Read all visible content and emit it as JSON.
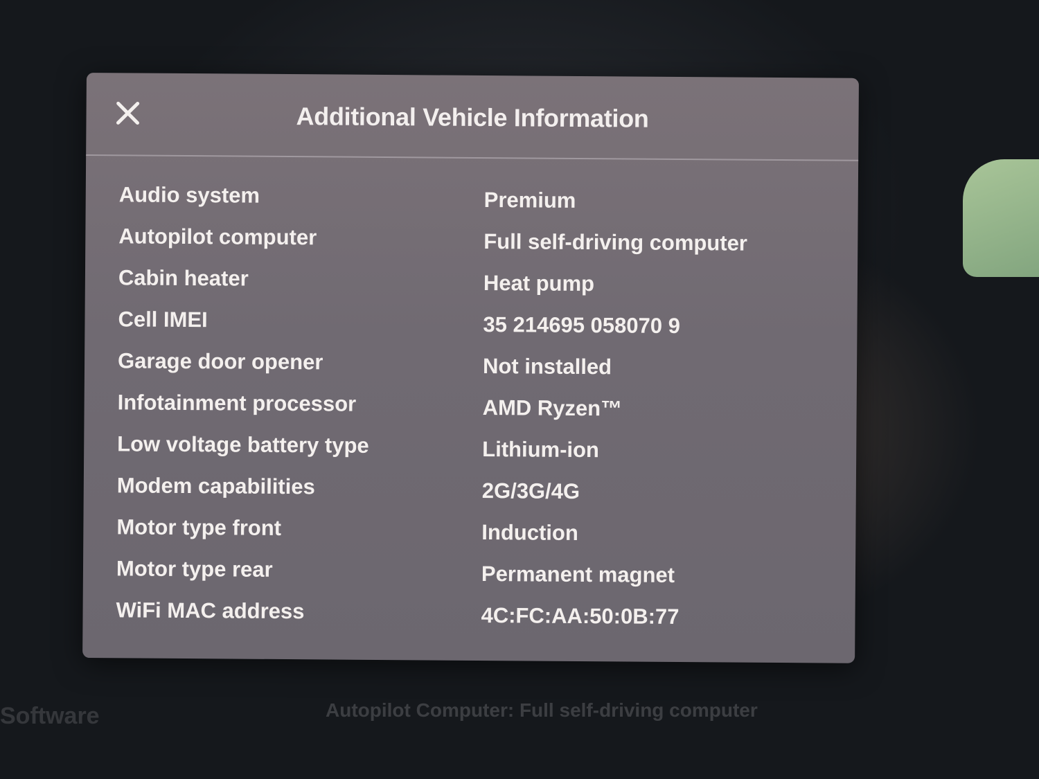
{
  "background": {
    "nav_items": [
      "Software"
    ],
    "footer_text": "Autopilot Computer: Full self-driving computer"
  },
  "dialog": {
    "title": "Additional Vehicle Information",
    "close_icon": "close-icon",
    "rows": [
      {
        "label": "Audio system",
        "value": "Premium"
      },
      {
        "label": "Autopilot computer",
        "value": "Full self-driving computer"
      },
      {
        "label": "Cabin heater",
        "value": "Heat pump"
      },
      {
        "label": "Cell IMEI",
        "value": "35 214695 058070 9"
      },
      {
        "label": "Garage door opener",
        "value": "Not installed"
      },
      {
        "label": "Infotainment processor",
        "value": "AMD Ryzen™"
      },
      {
        "label": "Low voltage battery type",
        "value": "Lithium-ion"
      },
      {
        "label": "Modem capabilities",
        "value": "2G/3G/4G"
      },
      {
        "label": "Motor type front",
        "value": "Induction"
      },
      {
        "label": "Motor type rear",
        "value": "Permanent magnet"
      },
      {
        "label": "WiFi MAC address",
        "value": "4C:FC:AA:50:0B:77"
      }
    ]
  },
  "colors": {
    "modal_background": "#736d74",
    "text": "#f4f0ee",
    "screen_background": "#171a1f"
  }
}
